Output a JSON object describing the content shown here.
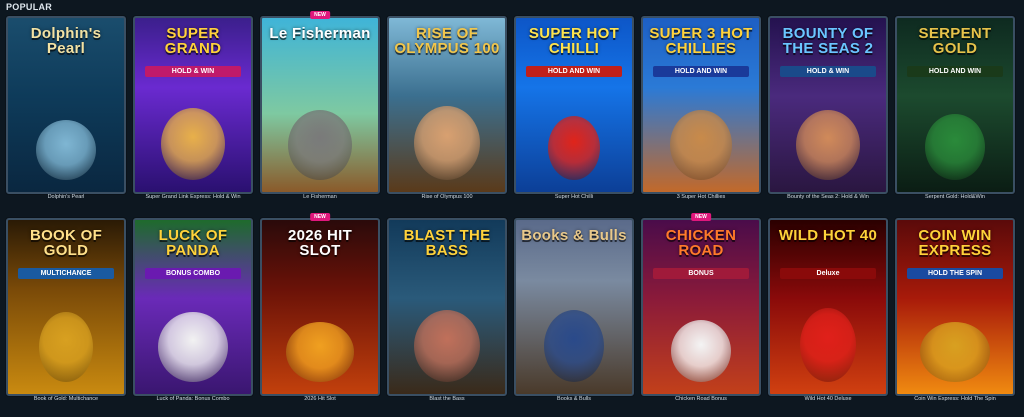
{
  "section": {
    "title": "POPULAR"
  },
  "badge_text": "NEW",
  "games": [
    {
      "label": "Dolphin's Pearl",
      "art_title": "Dolphin's Pearl",
      "art_sub": "",
      "is_new": false,
      "title_color": "#f3e2a3",
      "sub_bg": "",
      "figure_color": "#7fb6d3"
    },
    {
      "label": "Super Grand Link Express: Hold & Win",
      "art_title": "SUPER GRAND",
      "art_sub": "HOLD & WIN",
      "is_new": false,
      "title_color": "#ffd23a",
      "sub_bg": "#c01a6a",
      "figure_color": "#e8b04a"
    },
    {
      "label": "Le Fisherman",
      "art_title": "Le Fisherman",
      "art_sub": "",
      "is_new": true,
      "title_color": "#ffffff",
      "sub_bg": "",
      "figure_color": "#7a7a7a"
    },
    {
      "label": "Rise of Olympus 100",
      "art_title": "RISE OF OLYMPUS 100",
      "art_sub": "",
      "is_new": false,
      "title_color": "#f2c64a",
      "sub_bg": "",
      "figure_color": "#d8a070"
    },
    {
      "label": "Super Hot Chilli",
      "art_title": "SUPER HOT CHILLI",
      "art_sub": "HOLD AND WIN",
      "is_new": false,
      "title_color": "#ffe34a",
      "sub_bg": "#c0201a",
      "figure_color": "#e0241a"
    },
    {
      "label": "3 Super Hot Chillies",
      "art_title": "SUPER 3 HOT CHILLIES",
      "art_sub": "HOLD AND WIN",
      "is_new": false,
      "title_color": "#ffd23a",
      "sub_bg": "#1a3a9a",
      "figure_color": "#c88a4a"
    },
    {
      "label": "Bounty of the Seas 2: Hold & Win",
      "art_title": "BOUNTY OF THE SEAS 2",
      "art_sub": "HOLD & WIN",
      "is_new": false,
      "title_color": "#6ac6ff",
      "sub_bg": "#1a4a8a",
      "figure_color": "#d08a5a"
    },
    {
      "label": "Serpent Gold: Hold&Win",
      "art_title": "SERPENT GOLD",
      "art_sub": "HOLD AND WIN",
      "is_new": false,
      "title_color": "#e6c24a",
      "sub_bg": "#1a3a1a",
      "figure_color": "#2a8a3a"
    },
    {
      "label": "Book of Gold: Multichance",
      "art_title": "BOOK OF GOLD",
      "art_sub": "MULTICHANCE",
      "is_new": false,
      "title_color": "#ffe08a",
      "sub_bg": "#1a5aa0",
      "figure_color": "#d8a020"
    },
    {
      "label": "Luck of Panda: Bonus Combo",
      "art_title": "LUCK OF PANDA",
      "art_sub": "BONUS COMBO",
      "is_new": false,
      "title_color": "#ffd23a",
      "sub_bg": "#6a1ab0",
      "figure_color": "#f2f2f2"
    },
    {
      "label": "2026 Hit Slot",
      "art_title": "2026 HIT SLOT",
      "art_sub": "",
      "is_new": true,
      "title_color": "#ffffff",
      "sub_bg": "",
      "figure_color": "#f0a020"
    },
    {
      "label": "Blast the Bass",
      "art_title": "BLAST THE BASS",
      "art_sub": "",
      "is_new": false,
      "title_color": "#ffd23a",
      "sub_bg": "",
      "figure_color": "#c0705a"
    },
    {
      "label": "Books & Bulls",
      "art_title": "Books & Bulls",
      "art_sub": "",
      "is_new": false,
      "title_color": "#e8c88a",
      "sub_bg": "",
      "figure_color": "#2a4a8a"
    },
    {
      "label": "Chicken Road Bonus",
      "art_title": "CHICKEN ROAD",
      "art_sub": "BONUS",
      "is_new": true,
      "title_color": "#ff7a2a",
      "sub_bg": "#a01a3a",
      "figure_color": "#f4f4f4"
    },
    {
      "label": "Wild Hot 40 Deluxe",
      "art_title": "WILD HOT 40",
      "art_sub": "Deluxe",
      "is_new": false,
      "title_color": "#ffd23a",
      "sub_bg": "#8a0a0a",
      "figure_color": "#e0201a"
    },
    {
      "label": "Coin Win Express: Hold The Spin",
      "art_title": "COIN WIN EXPRESS",
      "art_sub": "HOLD THE SPIN",
      "is_new": false,
      "title_color": "#ffd23a",
      "sub_bg": "#1a4aa0",
      "figure_color": "#d8a020"
    }
  ]
}
